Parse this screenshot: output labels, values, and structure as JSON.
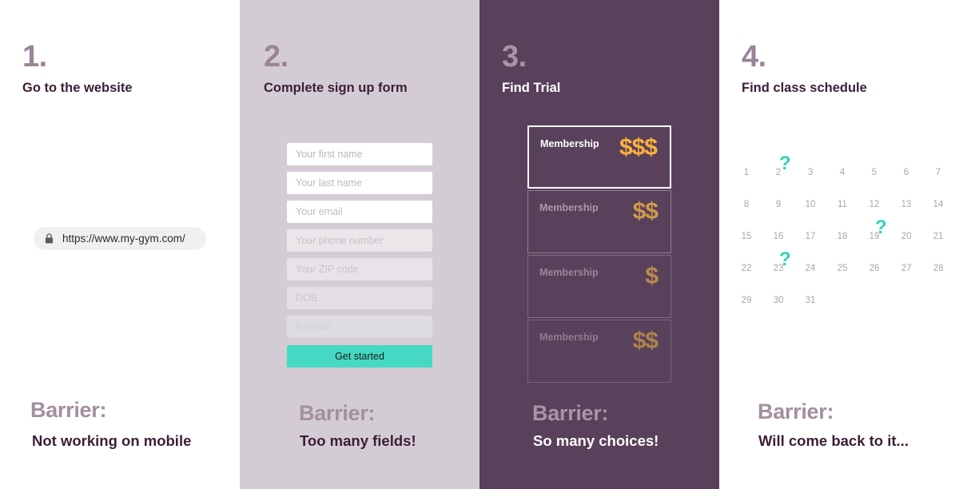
{
  "colors": {
    "accent_teal": "#45d8c2",
    "qmark_teal": "#2fd3b4",
    "plum_dark": "#59405b",
    "plum_light": "#d4ccd4",
    "ink": "#3b1f36",
    "muted_purple": "#9a8496",
    "gold": "#fbb03b"
  },
  "columns": [
    {
      "number": "1.",
      "title": "Go to the website",
      "barrier_label": "Barrier:",
      "barrier_text": "Not working on mobile",
      "url_bar": {
        "icon": "lock-icon",
        "value": "https://www.my-gym.com/"
      }
    },
    {
      "number": "2.",
      "title": "Complete sign up form",
      "barrier_label": "Barrier:",
      "barrier_text": "Too many fields!",
      "form": {
        "fields": [
          {
            "placeholder": "Your first name"
          },
          {
            "placeholder": "Your last name"
          },
          {
            "placeholder": "Your email"
          },
          {
            "placeholder": "Your phone number"
          },
          {
            "placeholder": "Your ZIP code"
          },
          {
            "placeholder": "DOB"
          },
          {
            "placeholder": "Referral"
          }
        ],
        "submit_label": "Get started"
      }
    },
    {
      "number": "3.",
      "title": "Find Trial",
      "barrier_label": "Barrier:",
      "barrier_text": "So many choices!",
      "plans": [
        {
          "name": "Membership",
          "price": "$$$"
        },
        {
          "name": "Membership",
          "price": "$$"
        },
        {
          "name": "Membership",
          "price": "$"
        },
        {
          "name": "Membership",
          "price": "$$"
        }
      ]
    },
    {
      "number": "4.",
      "title": "Find class schedule",
      "barrier_label": "Barrier:",
      "barrier_text": "Will come back to it...",
      "calendar": {
        "days": [
          "1",
          "2",
          "3",
          "4",
          "5",
          "6",
          "7",
          "8",
          "9",
          "10",
          "11",
          "12",
          "13",
          "14",
          "15",
          "16",
          "17",
          "18",
          "19",
          "20",
          "21",
          "22",
          "23",
          "24",
          "25",
          "26",
          "27",
          "28",
          "29",
          "30",
          "31"
        ],
        "marked_days": [
          "2",
          "19",
          "23"
        ],
        "mark_glyph": "?"
      }
    }
  ]
}
